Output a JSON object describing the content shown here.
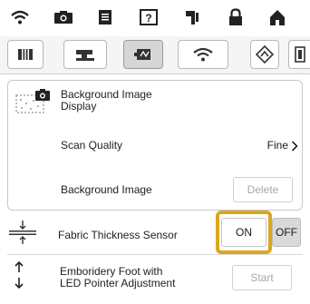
{
  "top_tabs": [
    {
      "icon": "wifi-icon"
    },
    {
      "icon": "camera-icon"
    },
    {
      "icon": "document-icon"
    },
    {
      "icon": "help-icon"
    },
    {
      "icon": "needle-icon"
    },
    {
      "icon": "lock-icon"
    },
    {
      "icon": "home-icon"
    }
  ],
  "icon_row": [
    {
      "icon": "book-icon"
    },
    {
      "icon": "sewing-machine-icon"
    },
    {
      "icon": "embroidery-frame-icon",
      "active": true
    },
    {
      "icon": "wifi-icon"
    },
    {
      "icon": "diamond-arrow-icon"
    },
    {
      "icon": "page-edge-icon"
    }
  ],
  "settings": {
    "bg_image_display": {
      "label_line1": "Background Image",
      "label_line2": "Display",
      "icon": "camera-pattern-icon"
    },
    "scan_quality": {
      "label": "Scan Quality",
      "value": "Fine",
      "chevron": ">"
    },
    "background_image": {
      "label": "Background Image",
      "button": "Delete"
    },
    "fabric_thickness": {
      "label": "Fabric Thickness Sensor",
      "on_label": "ON",
      "off_label": "OFF",
      "icon": "thickness-icon"
    },
    "foot_pointer": {
      "label_line1": "Emboridery Foot with",
      "label_line2": "LED Pointer Adjustment",
      "button": "Start",
      "icon": "updown-arrow-icon"
    }
  },
  "colors": {
    "highlight": "#d9a820",
    "off_bg": "#d9d9d9"
  }
}
